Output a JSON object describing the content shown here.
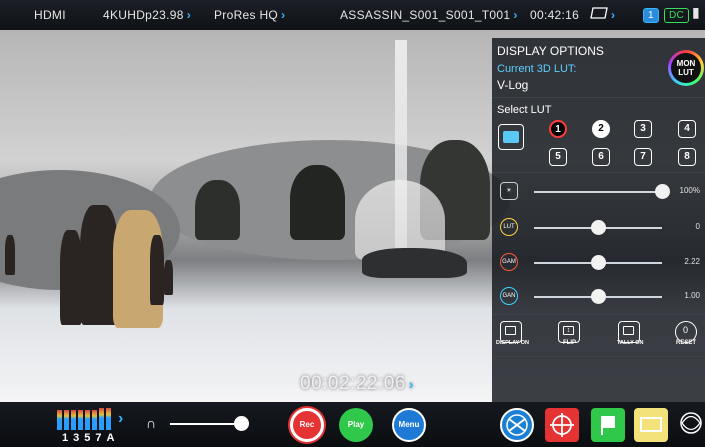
{
  "topbar": {
    "input": "HDMI",
    "format": "4KUHDp23.98",
    "codec": "ProRes HQ",
    "filename": "ASSASSIN_S001_S001_T001",
    "remaining": "00:42:16",
    "slot": "1",
    "power": "DC"
  },
  "video": {
    "timecode": "00:02:22:06"
  },
  "panel": {
    "title": "DISPLAY OPTIONS",
    "current_lut_label": "Current 3D LUT:",
    "current_lut_value": "V-Log",
    "monlut_line1": "MON",
    "monlut_line2": "LUT",
    "select_lut_label": "Select LUT",
    "lut_slots": [
      "1",
      "2",
      "3",
      "4",
      "5",
      "6",
      "7",
      "8"
    ],
    "sliders": [
      {
        "icon": "brightness-icon",
        "value_text": "100%",
        "level": 1.0
      },
      {
        "icon": "lut-icon",
        "value_text": "0",
        "level": 0.5
      },
      {
        "icon": "gamma-icon",
        "value_text": "2.22",
        "level": 0.5
      },
      {
        "icon": "gain-icon",
        "value_text": "1.00",
        "level": 0.5
      }
    ],
    "actions": [
      {
        "label": "DISPLAY ON"
      },
      {
        "label": "FLIP"
      },
      {
        "label": "TALLY ON"
      },
      {
        "label": "RESET",
        "glyph": "0"
      }
    ]
  },
  "bottombar": {
    "meter_labels": "1357A",
    "rec_label": "Rec",
    "play_label": "Play",
    "menu_label": "Menu",
    "volume_level": 0.95,
    "colors": {
      "rec": "#e53232",
      "play": "#2fc84a",
      "menu": "#1f7ad6",
      "accent": "#33b5ff"
    }
  }
}
